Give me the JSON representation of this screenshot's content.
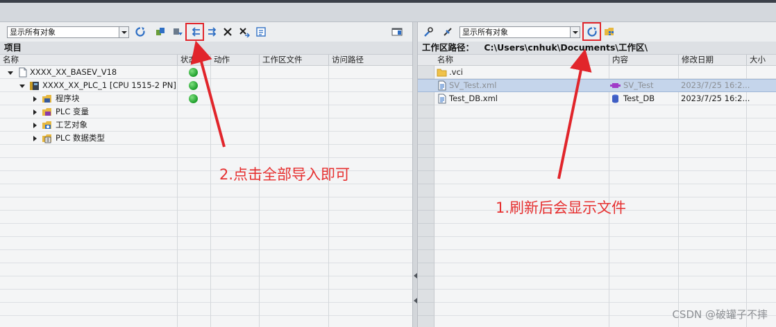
{
  "left": {
    "filter_value": "显示所有对象",
    "header": "项目",
    "columns": [
      "名称",
      "状态",
      "动作",
      "工作区文件",
      "访问路径"
    ],
    "tree": [
      {
        "label": "XXXX_XX_BASEV_V18",
        "status": "green"
      },
      {
        "label": "XXXX_XX_PLC_1 [CPU 1515-2 PN]",
        "status": "green"
      },
      {
        "label": "程序块",
        "status": "green"
      },
      {
        "label": "PLC 变量",
        "status": ""
      },
      {
        "label": "工艺对象",
        "status": ""
      },
      {
        "label": "PLC 数据类型",
        "status": ""
      }
    ]
  },
  "right": {
    "filter_value": "显示所有对象",
    "path_label": "工作区路径：",
    "path_value": "C:\\Users\\cnhuk\\Documents\\工作区\\",
    "columns": [
      "名称",
      "内容",
      "修改日期",
      "大小"
    ],
    "files": [
      {
        "name": ".vci",
        "content": "",
        "date": ""
      },
      {
        "name": "SV_Test.xml",
        "content": "SV_Test",
        "date": "2023/7/25 16:2..."
      },
      {
        "name": "Test_DB.xml",
        "content": "Test_DB",
        "date": "2023/7/25 16:2..."
      }
    ]
  },
  "annotations": {
    "step2": "2.点击全部导入即可",
    "step1": "1.刷新后会显示文件"
  },
  "watermark": "CSDN @破罐子不摔",
  "colors": {
    "annotation": "#e1252b",
    "status_green": "#1c9d2a",
    "selection": "#c5d5eb"
  }
}
